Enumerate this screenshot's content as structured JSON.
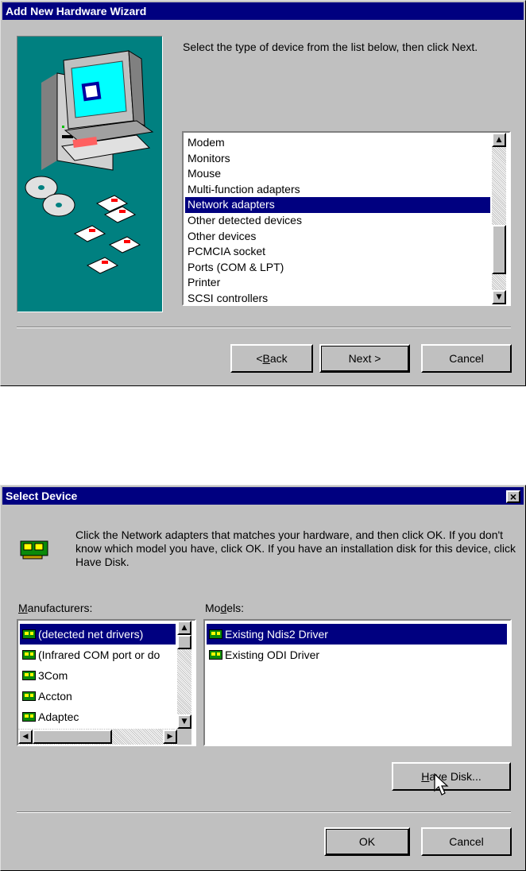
{
  "wizard": {
    "title": "Add New Hardware Wizard",
    "instruction": "Select the type of device from the list below, then click Next.",
    "device_types": [
      {
        "label": "Modem",
        "selected": false
      },
      {
        "label": "Monitors",
        "selected": false
      },
      {
        "label": "Mouse",
        "selected": false
      },
      {
        "label": "Multi-function adapters",
        "selected": false
      },
      {
        "label": "Network adapters",
        "selected": true
      },
      {
        "label": "Other detected devices",
        "selected": false
      },
      {
        "label": "Other devices",
        "selected": false
      },
      {
        "label": "PCMCIA socket",
        "selected": false
      },
      {
        "label": "Ports (COM & LPT)",
        "selected": false
      },
      {
        "label": "Printer",
        "selected": false
      },
      {
        "label": "SCSI controllers",
        "selected": false
      }
    ],
    "buttons": {
      "back": {
        "pre": "< ",
        "key": "B",
        "post": "ack"
      },
      "next": "Next >",
      "cancel": "Cancel"
    }
  },
  "select_device": {
    "title": "Select Device",
    "close_glyph": "×",
    "instruction": "Click the Network adapters that matches your hardware, and then click OK. If you don't know which model you have, click OK. If you have an installation disk for this device, click Have Disk.",
    "manufacturers_label": {
      "key": "M",
      "rest": "anufacturers:"
    },
    "models_label": {
      "pre": "Mo",
      "key": "d",
      "post": "els:"
    },
    "manufacturers": [
      {
        "label": "(detected net drivers)",
        "selected": true
      },
      {
        "label": "(Infrared COM port or do",
        "selected": false
      },
      {
        "label": "3Com",
        "selected": false
      },
      {
        "label": "Accton",
        "selected": false
      },
      {
        "label": "Adaptec",
        "selected": false
      }
    ],
    "models": [
      {
        "label": "Existing Ndis2 Driver",
        "selected": true
      },
      {
        "label": "Existing ODI Driver",
        "selected": false
      }
    ],
    "buttons": {
      "have_disk": {
        "key": "H",
        "rest": "ave Disk..."
      },
      "ok": "OK",
      "cancel": "Cancel"
    }
  },
  "colors": {
    "titlebar": "#000080",
    "dialog_face": "#c0c0c0",
    "illustration_bg": "#008080",
    "selection": "#000080"
  }
}
